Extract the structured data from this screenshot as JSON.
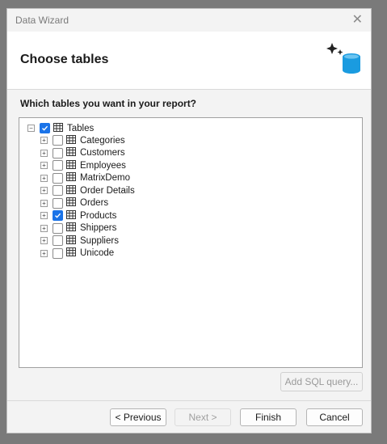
{
  "window": {
    "title": "Data Wizard",
    "close_icon": "close-icon"
  },
  "header": {
    "title": "Choose tables",
    "icon": "database-sparkle-icon"
  },
  "prompt": "Which tables you want in your report?",
  "tree": {
    "root": {
      "label": "Tables",
      "checked": true,
      "expanded": true
    },
    "items": [
      {
        "label": "Categories",
        "checked": false
      },
      {
        "label": "Customers",
        "checked": false
      },
      {
        "label": "Employees",
        "checked": false
      },
      {
        "label": "MatrixDemo",
        "checked": false
      },
      {
        "label": "Order Details",
        "checked": false
      },
      {
        "label": "Orders",
        "checked": false
      },
      {
        "label": "Products",
        "checked": true
      },
      {
        "label": "Shippers",
        "checked": false
      },
      {
        "label": "Suppliers",
        "checked": false
      },
      {
        "label": "Unicode",
        "checked": false
      }
    ]
  },
  "buttons": {
    "add_sql": "Add SQL query...",
    "previous": "< Previous",
    "next": "Next >",
    "finish": "Finish",
    "cancel": "Cancel"
  },
  "colors": {
    "accent": "#1a73e8",
    "db_icon": "#1a9be0"
  }
}
